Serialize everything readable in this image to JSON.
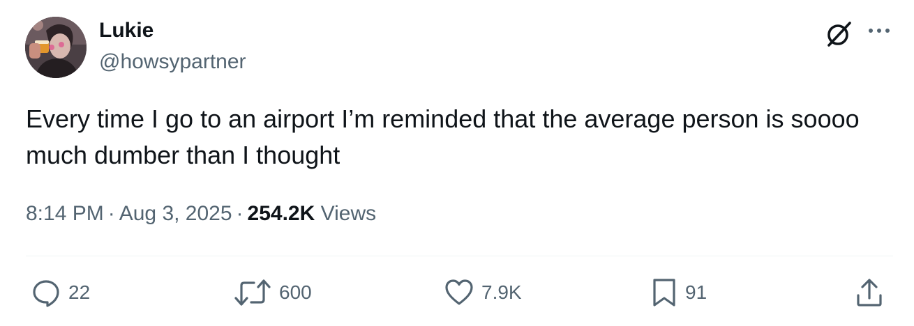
{
  "author": {
    "display_name": "Lukie",
    "handle": "@howsypartner",
    "avatar_icon": "avatar-photo"
  },
  "header_icons": [
    "grok-icon",
    "more-icon"
  ],
  "tweet": {
    "text": "Every time I go to an airport I’m reminded that the average person is soooo much dumber than I thought"
  },
  "meta": {
    "time": "8:14 PM",
    "separator": "·",
    "date": "Aug 3, 2025",
    "views_count": "254.2K",
    "views_label": "Views"
  },
  "actions": {
    "replies": "22",
    "reposts": "600",
    "likes": "7.9K",
    "bookmarks": "91"
  },
  "colors": {
    "text_primary": "#0f1419",
    "text_secondary": "#536471",
    "divider": "#eff3f4"
  }
}
